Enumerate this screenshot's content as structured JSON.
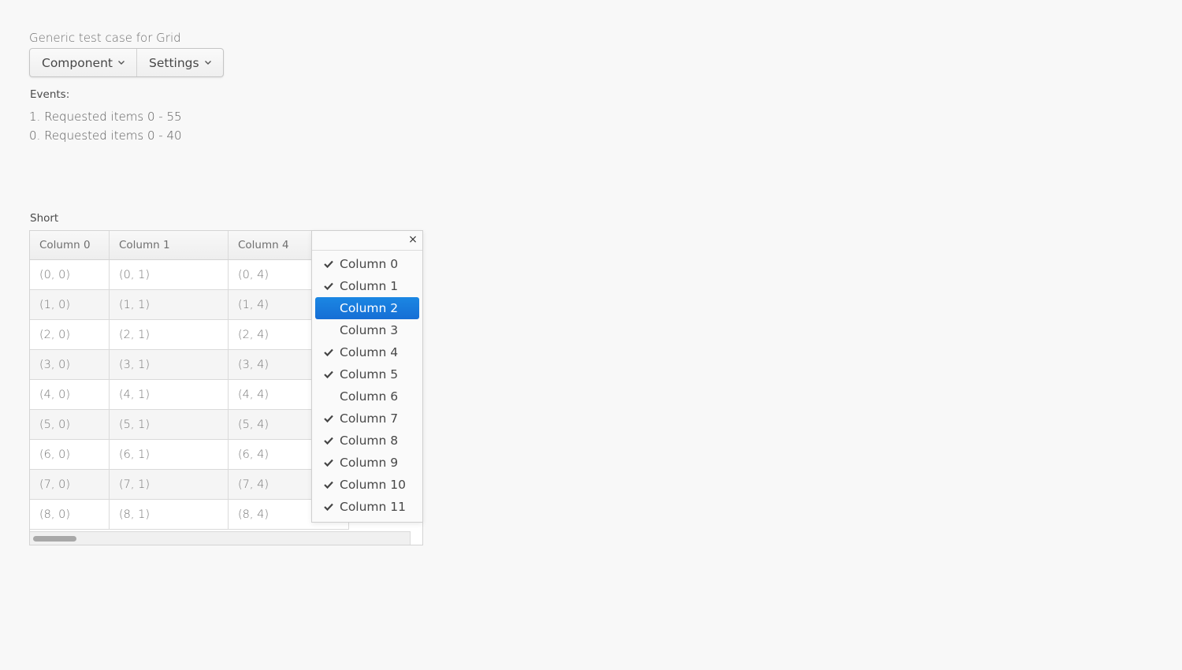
{
  "page": {
    "caption": "Generic test case for Grid"
  },
  "menubar": {
    "items": [
      {
        "label": "Component",
        "icon": "chevron-down-icon"
      },
      {
        "label": "Settings",
        "icon": "chevron-down-icon"
      }
    ]
  },
  "events": {
    "caption": "Events:",
    "entries": [
      "1. Requested items 0 - 55",
      "0. Requested items 0 - 40"
    ]
  },
  "grid": {
    "caption": "Short",
    "columns": [
      "Column 0",
      "Column 1",
      "Column 4"
    ],
    "rows": [
      [
        "(0, 0)",
        "(0, 1)",
        "(0, 4)"
      ],
      [
        "(1, 0)",
        "(1, 1)",
        "(1, 4)"
      ],
      [
        "(2, 0)",
        "(2, 1)",
        "(2, 4)"
      ],
      [
        "(3, 0)",
        "(3, 1)",
        "(3, 4)"
      ],
      [
        "(4, 0)",
        "(4, 1)",
        "(4, 4)"
      ],
      [
        "(5, 0)",
        "(5, 1)",
        "(5, 4)"
      ],
      [
        "(6, 0)",
        "(6, 1)",
        "(6, 4)"
      ],
      [
        "(7, 0)",
        "(7, 1)",
        "(7, 4)"
      ],
      [
        "(8, 0)",
        "(8, 1)",
        "(8, 4)"
      ]
    ]
  },
  "sidebar": {
    "close_icon": "close-icon",
    "close_label": "×",
    "items": [
      {
        "label": "Column 0",
        "checked": true,
        "selected": false
      },
      {
        "label": "Column 1",
        "checked": true,
        "selected": false
      },
      {
        "label": "Column 2",
        "checked": false,
        "selected": true
      },
      {
        "label": "Column 3",
        "checked": false,
        "selected": false
      },
      {
        "label": "Column 4",
        "checked": true,
        "selected": false
      },
      {
        "label": "Column 5",
        "checked": true,
        "selected": false
      },
      {
        "label": "Column 6",
        "checked": false,
        "selected": false
      },
      {
        "label": "Column 7",
        "checked": true,
        "selected": false
      },
      {
        "label": "Column 8",
        "checked": true,
        "selected": false
      },
      {
        "label": "Column 9",
        "checked": true,
        "selected": false
      },
      {
        "label": "Column 10",
        "checked": true,
        "selected": false
      },
      {
        "label": "Column 11",
        "checked": true,
        "selected": false
      }
    ]
  },
  "colors": {
    "accent": "#197de1",
    "background": "#f8f8f8"
  }
}
